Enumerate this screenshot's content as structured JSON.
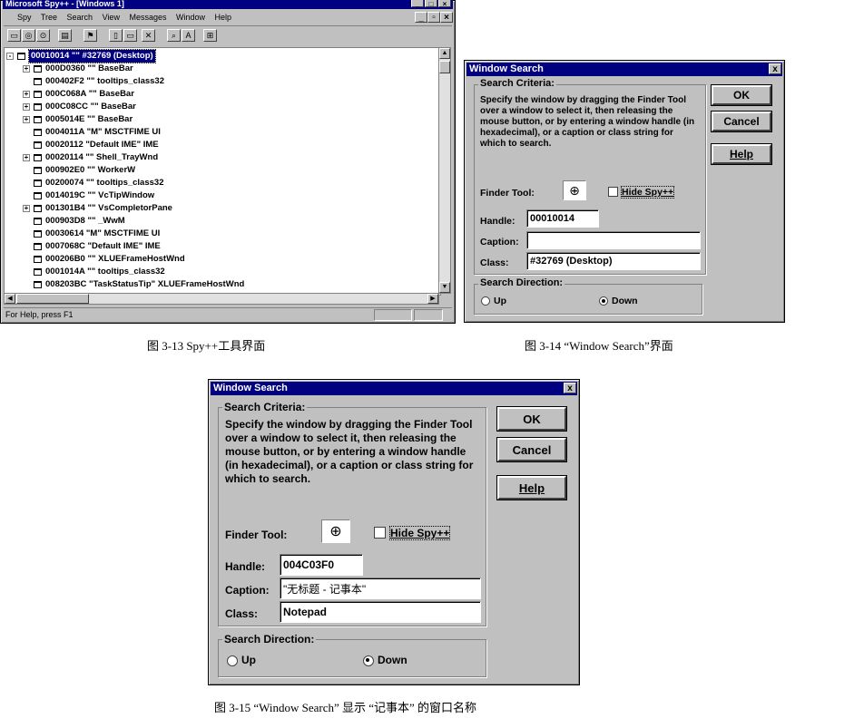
{
  "spy": {
    "title": "Microsoft Spy++ - [Windows 1]",
    "menu": [
      "Spy",
      "Tree",
      "Search",
      "View",
      "Messages",
      "Window",
      "Help"
    ],
    "toolbar_icons": [
      "new-window-icon",
      "messages-icon",
      "processes-icon",
      "threads-icon",
      "find-window-icon",
      "properties-icon",
      "refresh-icon",
      "close-icon",
      "finder-icon",
      "font-icon",
      "tile-icon"
    ],
    "rows": [
      {
        "text": "00010014 \"\" #32769 (Desktop)",
        "selected": true,
        "expand": "-"
      },
      {
        "text": "000D0360 \"\" BaseBar",
        "expand": "+"
      },
      {
        "text": "000402F2 \"\" tooltips_class32",
        "expand": ""
      },
      {
        "text": "000C068A \"\" BaseBar",
        "expand": "+"
      },
      {
        "text": "000C08CC \"\" BaseBar",
        "expand": "+"
      },
      {
        "text": "0005014E \"\" BaseBar",
        "expand": "+"
      },
      {
        "text": "0004011A \"M\" MSCTFIME UI",
        "expand": ""
      },
      {
        "text": "00020112 \"Default IME\" IME",
        "expand": ""
      },
      {
        "text": "00020114 \"\" Shell_TrayWnd",
        "expand": "+"
      },
      {
        "text": "000902E0 \"\" WorkerW",
        "expand": ""
      },
      {
        "text": "00200074 \"\" tooltips_class32",
        "expand": ""
      },
      {
        "text": "0014019C \"\" VcTipWindow",
        "expand": ""
      },
      {
        "text": "001301B4 \"\" VsCompletorPane",
        "expand": "+"
      },
      {
        "text": "000903D8 \"\" _WwM",
        "expand": ""
      },
      {
        "text": "00030614 \"M\" MSCTFIME UI",
        "expand": ""
      },
      {
        "text": "0007068C \"Default IME\" IME",
        "expand": ""
      },
      {
        "text": "000206B0 \"\" XLUEFrameHostWnd",
        "expand": ""
      },
      {
        "text": "0001014A \"\" tooltips_class32",
        "expand": ""
      },
      {
        "text": "008203BC \"TaskStatusTip\" XLUEFrameHostWnd",
        "expand": ""
      }
    ],
    "status": "For Help, press F1"
  },
  "dialog": {
    "title": "Window Search",
    "criteria_label": "Search Criteria:",
    "description": "Specify the window by dragging the Finder Tool over a window to select it, then releasing the mouse button, or by entering a window handle (in hexadecimal), or a caption or class string for which to search.",
    "ok": "OK",
    "cancel": "Cancel",
    "help": "Help",
    "finder_label": "Finder Tool:",
    "hide_spy": "Hide Spy++",
    "handle_label": "Handle:",
    "caption_label": "Caption:",
    "class_label": "Class:",
    "direction_label": "Search Direction:",
    "up": "Up",
    "down": "Down",
    "close_glyph": "x"
  },
  "dialog1_values": {
    "handle": "00010014",
    "caption": "",
    "class": "#32769 (Desktop)"
  },
  "dialog2_values": {
    "handle": "004C03F0",
    "caption": "\"无标题 - 记事本\"",
    "class": "Notepad"
  },
  "captions": {
    "fig13": "图 3-13   Spy++工具界面",
    "fig14": "图 3-14  “Window Search”界面",
    "fig15": "图 3-15  “Window Search” 显示 “记事本” 的窗口名称"
  }
}
